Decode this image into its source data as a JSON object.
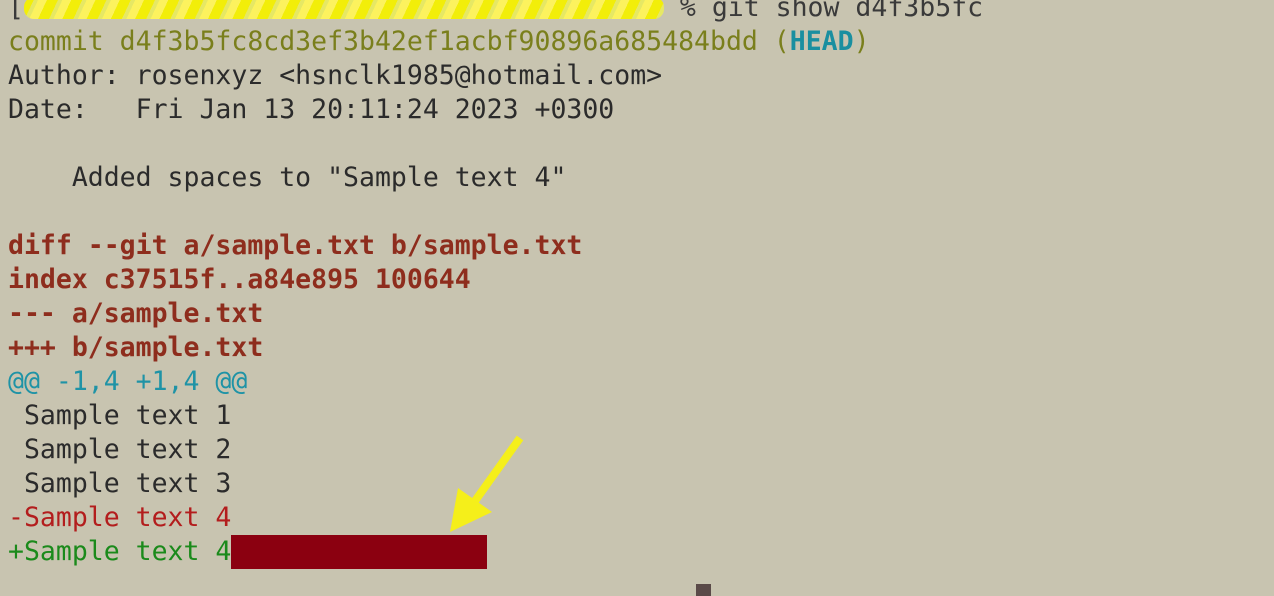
{
  "terminal": {
    "prompt_line": {
      "prompt_end": "[",
      "command": " % git show d4f3b5fc"
    },
    "commit": {
      "label": "commit d4f3b5fc8cd3ef3b42ef1acbf90896a685484bdd (",
      "ref": "HEAD",
      "close": ")"
    },
    "author": "Author: rosenxyz <hsnclk1985@hotmail.com>",
    "date": "Date:   Fri Jan 13 20:11:24 2023 +0300",
    "message": "    Added spaces to \"Sample text 4\"",
    "diff_header": "diff --git a/sample.txt b/sample.txt",
    "index": "index c37515f..a84e895 100644",
    "file_a": "--- a/sample.txt",
    "file_b": "+++ b/sample.txt",
    "hunk": "@@ -1,4 +1,4 @@",
    "context": [
      " Sample text 1",
      " Sample text 2",
      " Sample text 3"
    ],
    "removed": "-Sample text 4",
    "added": "+Sample text 4"
  },
  "colors": {
    "background": "#c8c4b0",
    "commit": "#7a7f1c",
    "head_ref": "#1a8fa0",
    "diff_meta": "#8e2d1d",
    "hunk": "#1f93a6",
    "removed": "#b31d1d",
    "added": "#1b8a1b",
    "trailing_whitespace": "#8b0010",
    "arrow": "#f5ef1a"
  },
  "icons": {
    "annotation": "yellow-arrow-icon",
    "redaction": "redaction-scribble"
  }
}
